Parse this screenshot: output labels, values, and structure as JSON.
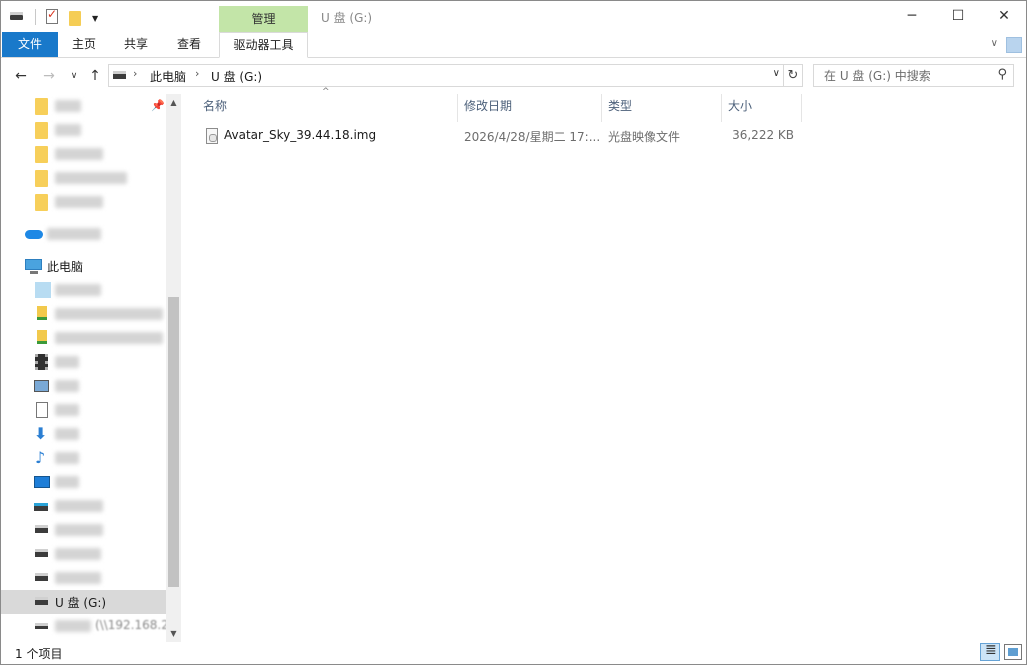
{
  "window": {
    "title": "U 盘 (G:)",
    "context_tab": "管理",
    "minimize": "─",
    "maximize": "☐",
    "close": "✕"
  },
  "ribbon": {
    "tabs": [
      {
        "label": "文件"
      },
      {
        "label": "主页"
      },
      {
        "label": "共享"
      },
      {
        "label": "查看"
      },
      {
        "label": "驱动器工具"
      }
    ]
  },
  "address": {
    "crumbs": [
      "此电脑",
      "U 盘 (G:)"
    ],
    "search_placeholder": "在 U 盘 (G:) 中搜索"
  },
  "navigation": {
    "this_pc_label": "此电脑",
    "selected_drive_label": "U 盘 (G:)",
    "network_drive_label": "(\\\\192.168.2"
  },
  "columns": [
    "名称",
    "修改日期",
    "类型",
    "大小"
  ],
  "files": [
    {
      "name": "Avatar_Sky_39.44.18.img",
      "modified": "2026/4/28/星期二 17:...",
      "type": "光盘映像文件",
      "size": "36,222 KB"
    }
  ],
  "status": {
    "item_count": "1 个项目"
  },
  "colors": {
    "accent": "#1979ca",
    "context_tab": "#c3e5a8",
    "selection": "#d9d9d9"
  }
}
